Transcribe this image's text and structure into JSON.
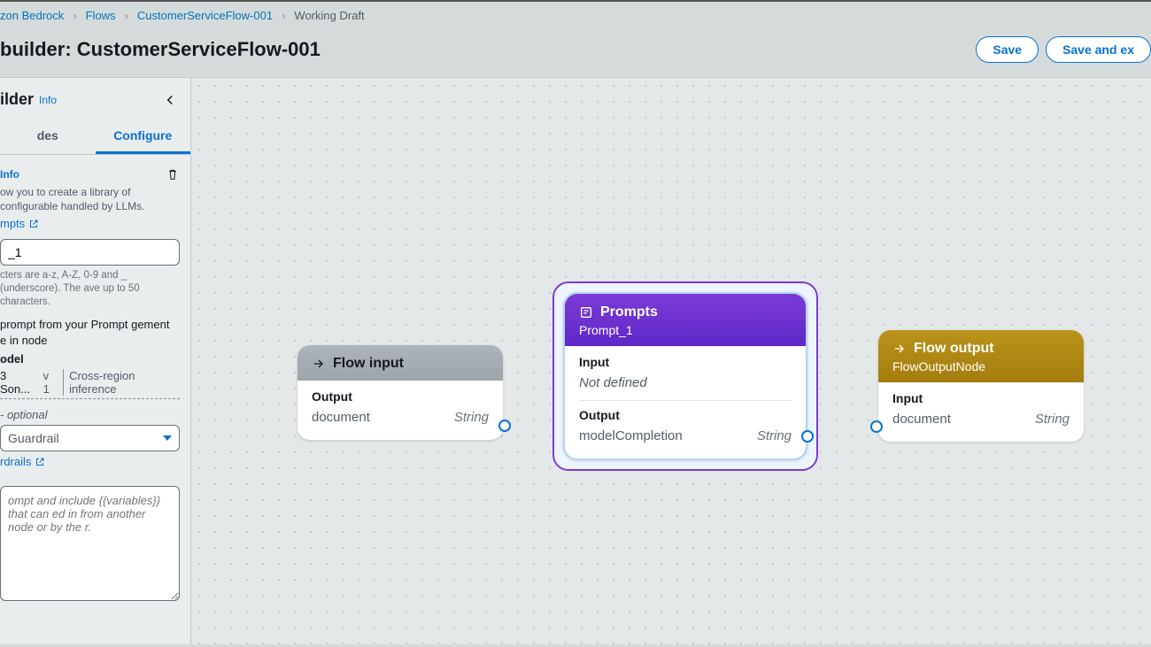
{
  "breadcrumb": {
    "b1": "zon Bedrock",
    "b2": "Flows",
    "b3": "CustomerServiceFlow-001",
    "b4": "Working Draft"
  },
  "title": " builder: CustomerServiceFlow-001",
  "buttons": {
    "save": "Save",
    "saveExit": "Save and ex"
  },
  "sidebar": {
    "header": "ilder",
    "info": "Info",
    "tabs": {
      "nodes": "des",
      "configure": "Configure"
    },
    "panel": {
      "info": "Info",
      "desc": "ow you to create a library of configurable handled by LLMs.",
      "promptsLink": "mpts",
      "nameValue": "_1",
      "nameHelp": "cters are a-z, A-Z, 0-9 and _ (underscore). The ave up to 50 characters.",
      "opt1": " prompt from your Prompt gement",
      "opt2": "e in node",
      "modelLabel": "odel",
      "modelName": "3 Son...",
      "modelV": "v 1",
      "crossRegion": "Cross-region inference",
      "guardLabel": " - optional",
      "guardSelect": " Guardrail",
      "guardLink": "rdrails",
      "msgPlaceholder": "ompt and include {{variables}} that can ed in from another node or by the r."
    }
  },
  "nodes": {
    "input": {
      "title": "Flow input",
      "outLabel": "Output",
      "outName": "document",
      "outType": "String"
    },
    "prompt": {
      "title": "Prompts",
      "sub": "Prompt_1",
      "inLabel": "Input",
      "inVal": "Not defined",
      "outLabel": "Output",
      "outName": "modelCompletion",
      "outType": "String"
    },
    "output": {
      "title": "Flow output",
      "sub": "FlowOutputNode",
      "inLabel": "Input",
      "inName": "document",
      "inType": "String"
    }
  }
}
